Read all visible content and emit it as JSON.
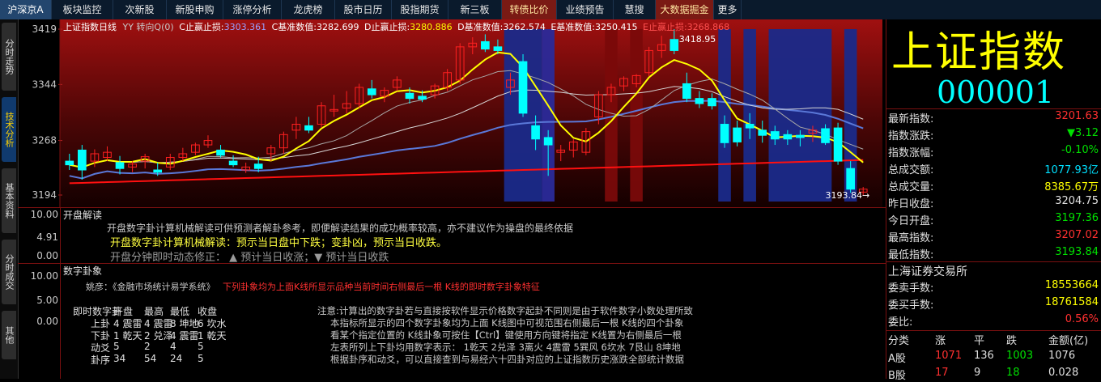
{
  "top_tabs": [
    {
      "label": "沪深京A",
      "style": "active"
    },
    {
      "label": "板块监控",
      "style": ""
    },
    {
      "label": "次新股",
      "style": ""
    },
    {
      "label": "新股申购",
      "style": ""
    },
    {
      "label": "涨停分析",
      "style": ""
    },
    {
      "label": "龙虎榜",
      "style": ""
    },
    {
      "label": "股市日历",
      "style": ""
    },
    {
      "label": "股指期货",
      "style": ""
    },
    {
      "label": "新三板",
      "style": ""
    },
    {
      "label": "转债比价",
      "style": "red"
    },
    {
      "label": "业绩预告",
      "style": ""
    },
    {
      "label": "慧搜",
      "style": ""
    },
    {
      "label": "大数据掘金",
      "style": "red"
    },
    {
      "label": "更多",
      "style": ""
    }
  ],
  "side_tabs": [
    {
      "label": "分时走势",
      "active": false
    },
    {
      "label": "技术分析",
      "active": true
    },
    {
      "label": "基本资料",
      "active": false
    },
    {
      "label": "分时成交",
      "active": false
    },
    {
      "label": "其他",
      "active": false
    }
  ],
  "chart_header": {
    "name": "上证指数日线",
    "mode": "YY 转向Q(0)",
    "c_label": "C止赢止损:",
    "c_value": "3303.361",
    "c_base_label": "C基准数值:",
    "c_base_value": "3282.699",
    "d_label": "D止赢止损:",
    "d_value": "3280.886",
    "d_base_label": "D基准数值:",
    "d_base_value": "3262.574",
    "e_base_label": "E基准数值:",
    "e_base_value": "3250.415",
    "e_label": "E止赢止损:",
    "e_value": "3268.868"
  },
  "price_axis": {
    "labels": [
      "3419",
      "3344",
      "3268",
      "3194"
    ]
  },
  "annotations": {
    "high": "3418.95",
    "low": "3193.84→"
  },
  "chart_data": {
    "type": "candlestick",
    "ylim": [
      3194,
      3419
    ],
    "candles": [
      [
        3240,
        3250,
        3228,
        3235
      ],
      [
        3255,
        3262,
        3215,
        3228
      ],
      [
        3240,
        3256,
        3232,
        3250
      ],
      [
        3245,
        3260,
        3240,
        3252
      ],
      [
        3238,
        3247,
        3222,
        3230
      ],
      [
        3232,
        3240,
        3225,
        3236
      ],
      [
        3240,
        3250,
        3230,
        3246
      ],
      [
        3228,
        3238,
        3220,
        3225
      ],
      [
        3232,
        3250,
        3228,
        3245
      ],
      [
        3245,
        3258,
        3240,
        3250
      ],
      [
        3252,
        3265,
        3248,
        3262
      ],
      [
        3262,
        3275,
        3258,
        3268
      ],
      [
        3255,
        3262,
        3245,
        3248
      ],
      [
        3240,
        3248,
        3232,
        3235
      ],
      [
        3228,
        3238,
        3224,
        3232
      ],
      [
        3236,
        3246,
        3225,
        3230
      ],
      [
        3250,
        3262,
        3240,
        3258
      ],
      [
        3258,
        3280,
        3250,
        3276
      ],
      [
        3282,
        3300,
        3270,
        3290
      ],
      [
        3288,
        3300,
        3278,
        3282
      ],
      [
        3290,
        3320,
        3285,
        3315
      ],
      [
        3308,
        3330,
        3300,
        3310
      ],
      [
        3312,
        3335,
        3305,
        3318
      ],
      [
        3318,
        3345,
        3312,
        3340
      ],
      [
        3338,
        3350,
        3325,
        3330
      ],
      [
        3328,
        3340,
        3320,
        3336
      ],
      [
        3340,
        3355,
        3335,
        3350
      ],
      [
        3332,
        3340,
        3318,
        3325
      ],
      [
        3328,
        3336,
        3320,
        3324
      ],
      [
        3330,
        3345,
        3325,
        3342
      ],
      [
        3340,
        3365,
        3335,
        3360
      ],
      [
        3350,
        3400,
        3345,
        3395
      ],
      [
        3395,
        3408,
        3385,
        3400
      ],
      [
        3402,
        3412,
        3388,
        3392
      ],
      [
        3395,
        3405,
        3385,
        3390
      ],
      [
        3340,
        3360,
        3330,
        3350
      ],
      [
        3375,
        3385,
        3300,
        3305
      ],
      [
        3288,
        3302,
        3255,
        3270
      ],
      [
        3272,
        3282,
        3220,
        3262
      ],
      [
        3252,
        3262,
        3240,
        3255
      ],
      [
        3255,
        3270,
        3245,
        3266
      ],
      [
        3252,
        3285,
        3248,
        3280
      ],
      [
        3300,
        3335,
        3290,
        3330
      ],
      [
        3330,
        3345,
        3320,
        3340
      ],
      [
        3342,
        3355,
        3335,
        3352
      ],
      [
        3345,
        3358,
        3340,
        3356
      ],
      [
        3360,
        3395,
        3355,
        3390
      ],
      [
        3390,
        3410,
        3380,
        3398
      ],
      [
        3405,
        3419,
        3385,
        3390
      ],
      [
        3345,
        3360,
        3320,
        3325
      ],
      [
        3325,
        3335,
        3312,
        3318
      ],
      [
        3325,
        3332,
        3310,
        3315
      ],
      [
        3290,
        3302,
        3258,
        3265
      ],
      [
        3285,
        3295,
        3260,
        3266
      ],
      [
        3290,
        3305,
        3270,
        3285
      ],
      [
        3282,
        3295,
        3265,
        3275
      ],
      [
        3280,
        3288,
        3262,
        3270
      ],
      [
        3276,
        3282,
        3262,
        3270
      ],
      [
        3275,
        3282,
        3260,
        3272
      ],
      [
        3278,
        3288,
        3266,
        3282
      ],
      [
        3284,
        3290,
        3262,
        3265
      ],
      [
        3285,
        3292,
        3235,
        3240
      ],
      [
        3230,
        3240,
        3197,
        3202
      ],
      [
        3198,
        3205,
        3194,
        3202
      ]
    ]
  },
  "panel1": {
    "yaxis": [
      "10.00",
      "4.91",
      "0.00"
    ],
    "title": "开盘解读",
    "line1": "开盘数字卦计算机械解读可供预测者解卦参考，即便解读结果的成功概率较高，亦不建议作为操盘的最终依据",
    "line2": "开盘数字卦计算机械解读：预示当日盘中下跌；变卦凶，预示当日收跌。",
    "line3": "开盘分钟即时动态修正：  ▲ 预计当日收涨；▼ 预计当日收跌"
  },
  "panel2": {
    "yaxis": [
      "10.00",
      "5.00",
      "0.00"
    ],
    "title": "数字卦象",
    "src_label": "姚彦：《金融市场统计易学系统》",
    "src_text": "下列卦象均为上面K线所显示品种当前时间右侧最后一根 K线的即时数字卦象特征",
    "table_header": [
      "即时数字卦",
      "开盘",
      "最高",
      "最低",
      "收盘"
    ],
    "table_rows": [
      [
        "上卦",
        "4 震雷",
        "4 震雷",
        "8 坤地",
        "6 坎水"
      ],
      [
        "下卦",
        "1 乾天",
        "2 兑泽",
        "4 震雷",
        "1 乾天"
      ],
      [
        "动爻",
        "5",
        "2",
        "4",
        "5"
      ],
      [
        "卦序",
        "34",
        "54",
        "24",
        "5"
      ]
    ],
    "note": [
      "注意:计算出的数字卦若与直接按软件显示价格数字起卦不同则是由于软件数字小数处理所致",
      "本指标所显示的四个数字卦象均为上面 K线图中可视范围右侧最后一根 K线的四个卦象",
      "看某个指定位置的 K线卦象可按住【Ctrl】键使用方向键将指定 K线置为右侧最后一根",
      "左表所列上下卦均用数字表示： 1乾天 2兑泽 3离火 4震雷 5巽风 6坎水 7艮山 8坤地",
      "根据卦序和动爻，可以直接查到与易经六十四卦对应的上证指数历史涨跌全部统计数据"
    ]
  },
  "right_panel": {
    "name": "上证指数",
    "code": "000001",
    "rows": [
      {
        "k": "最新指数:",
        "v": "3201.63",
        "c": "#ff3030"
      },
      {
        "k": "指数涨跌:",
        "v": "▼3.12",
        "c": "#00e000"
      },
      {
        "k": "指数涨幅:",
        "v": "-0.10%",
        "c": "#00e000"
      },
      {
        "k": "总成交额:",
        "v": "1077.93亿",
        "c": "#00e0ff"
      },
      {
        "k": "总成交量:",
        "v": "8385.67万",
        "c": "#ffff00"
      },
      {
        "k": "昨日收盘:",
        "v": "3204.75",
        "c": "#e0e0e0"
      },
      {
        "k": "今日开盘:",
        "v": "3197.36",
        "c": "#00e000"
      },
      {
        "k": "最高指数:",
        "v": "3207.02",
        "c": "#ff3030"
      },
      {
        "k": "最低指数:",
        "v": "3193.84",
        "c": "#00e000"
      }
    ],
    "exchange": "上海证券交易所",
    "rows2": [
      {
        "k": "委卖手数:",
        "v": "18553664",
        "c": "#ffff00"
      },
      {
        "k": "委买手数:",
        "v": "18761584",
        "c": "#ffff00"
      },
      {
        "k": "委比:",
        "v": "0.56%",
        "c": "#ff3030"
      }
    ],
    "table_header": [
      "分类",
      "涨",
      "平",
      "跌",
      "金额(亿)"
    ],
    "table_rows": [
      [
        "A股",
        "1071",
        "136",
        "1003",
        "1076"
      ],
      [
        "B股",
        "17",
        "9",
        "18",
        "0.028"
      ]
    ]
  },
  "colors": {
    "up": "#ff2020",
    "down": "#00ffff",
    "ma_yellow": "#ffff00",
    "ma_white": "#ffffff",
    "ma_blue": "#5a78d8",
    "ma_red": "#ff1010"
  }
}
